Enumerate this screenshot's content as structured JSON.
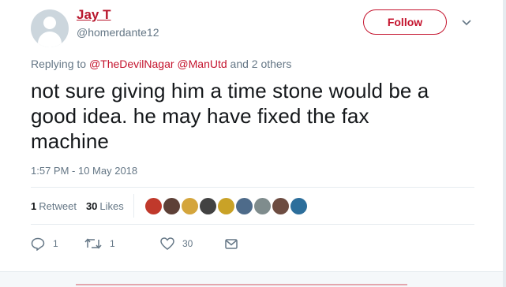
{
  "tweet": {
    "display_name": "Jay T",
    "handle": "@homerdante12",
    "follow_label": "Follow",
    "replying_prefix": "Replying to",
    "mention_1": "@TheDevilNagar",
    "mention_2": "@ManUtd",
    "replying_suffix": "and 2 others",
    "text": "not sure giving him a time stone would be a\ngood idea.  he may have fixed the fax\nmachine",
    "timestamp": "1:57 PM - 10 May 2018"
  },
  "stats": {
    "retweets_count": "1",
    "retweets_label": "Retweet",
    "likes_count": "30",
    "likes_label": "Likes",
    "liker_avatars": [
      "#c0392b",
      "#5d4037",
      "#d4a53c",
      "#424242",
      "#c9a227",
      "#4e6b8a",
      "#7f8c8d",
      "#6d4c41",
      "#2c6e9b"
    ]
  },
  "actions": {
    "reply_count": "1",
    "retweet_count": "1",
    "like_count": "30"
  },
  "colors": {
    "accent": "#c4132d",
    "muted": "#657786",
    "text": "#14171a"
  },
  "icons": [
    "avatar-placeholder-icon",
    "chevron-down-icon",
    "reply-icon",
    "retweet-icon",
    "heart-icon",
    "envelope-icon"
  ]
}
